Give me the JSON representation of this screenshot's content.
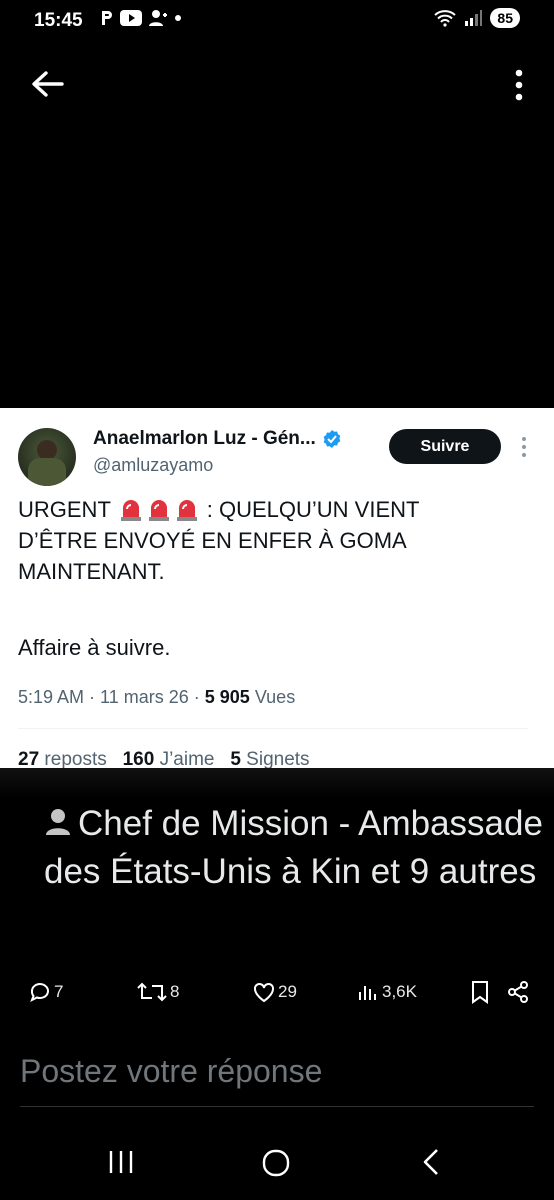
{
  "status_bar": {
    "time": "15:45",
    "left_icons": [
      "parking-icon",
      "youtube-icon",
      "person-add-icon",
      "dot-icon"
    ],
    "right_icons": [
      "wifi-icon",
      "signal-icon"
    ],
    "battery": "85"
  },
  "top_nav": {
    "back_icon": "arrow-left-icon",
    "more_icon": "kebab-icon"
  },
  "tweet_card": {
    "author_name": "Anaelmarlon Luz - Gén...",
    "handle": "@amluzayamo",
    "follow_label": "Suivre",
    "text_prefix": "URGENT",
    "text_emoji": "🚨🚨🚨",
    "text_line1_suffix": " : QUELQU’UN VIENT",
    "text_line2": "D’ÊTRE ENVOYÉ EN ENFER À GOMA",
    "text_line3": "MAINTENANT.",
    "text_followup": "Affaire à suivre.",
    "time": "5:19 AM",
    "date": "11 mars 26",
    "views_count": "5 905",
    "views_label": "Vues",
    "reposts_count": "27",
    "reposts_label": "reposts",
    "likes_count": "160",
    "likes_label": "J’aime",
    "bookmarks_count": "5",
    "bookmarks_label": "Signets"
  },
  "caption": {
    "text": "Chef de Mission - Ambassade des États-Unis à Kin et 9 autres",
    "icon": "person-icon"
  },
  "actions": {
    "replies": "7",
    "reposts": "8",
    "likes": "29",
    "views": "3,6K"
  },
  "reply_placeholder": "Postez votre réponse",
  "colors": {
    "accent": "#1d9bf0",
    "background": "#000000",
    "card": "#ffffff",
    "muted": "#71767b"
  }
}
